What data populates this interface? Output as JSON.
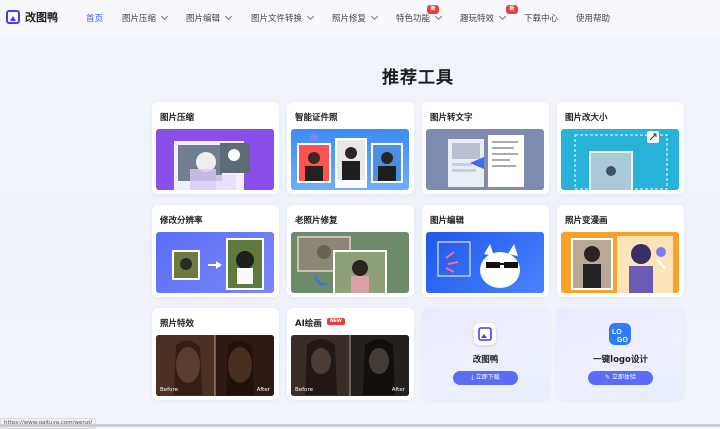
{
  "brand": {
    "name": "改图鸭"
  },
  "nav": {
    "items": [
      {
        "label": "首页",
        "active": true,
        "dropdown": false
      },
      {
        "label": "图片压缩",
        "dropdown": true
      },
      {
        "label": "图片编辑",
        "dropdown": true
      },
      {
        "label": "图片文件转换",
        "dropdown": true
      },
      {
        "label": "照片修复",
        "dropdown": true
      },
      {
        "label": "特色功能",
        "dropdown": true,
        "badge": "新"
      },
      {
        "label": "趣玩特效",
        "dropdown": true,
        "badge": "新"
      },
      {
        "label": "下载中心",
        "dropdown": false
      },
      {
        "label": "使用帮助",
        "dropdown": false
      }
    ]
  },
  "section": {
    "title": "推荐工具"
  },
  "cards": [
    {
      "title": "图片压缩"
    },
    {
      "title": "智能证件照"
    },
    {
      "title": "图片转文字"
    },
    {
      "title": "图片改大小"
    },
    {
      "title": "修改分辨率"
    },
    {
      "title": "老照片修复"
    },
    {
      "title": "图片编辑"
    },
    {
      "title": "照片变漫画"
    },
    {
      "title": "照片特效",
      "before": "Before",
      "after": "After"
    },
    {
      "title": "AI绘画",
      "tag": "NEW",
      "before": "Before",
      "after": "After"
    }
  ],
  "download_cards": [
    {
      "title": "改图鸭",
      "button": "立即下载"
    },
    {
      "title": "一键logo设计",
      "button": "立即体验"
    }
  ],
  "status_bar": {
    "url": "https://www.gaituya.com/wenzi/"
  },
  "colors": {
    "accent": "#3f5bff",
    "badge": "#e8413a",
    "button": "#5b6df7"
  }
}
